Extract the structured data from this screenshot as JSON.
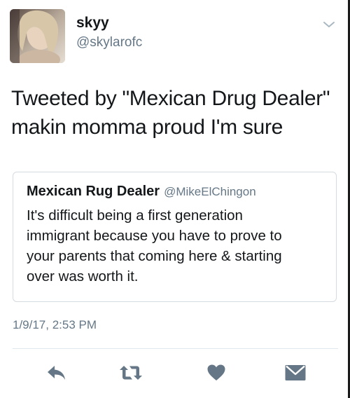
{
  "tweet": {
    "author": {
      "display_name": "skyy",
      "handle": "@skylarofc"
    },
    "text_lines": [
      "Tweeted by \"Mexican Drug Dealer\"",
      "makin momma proud I'm sure"
    ],
    "quoted": {
      "display_name": "Mexican Rug Dealer",
      "handle": "@MikeElChingon",
      "text_lines": [
        "It's difficult being a first generation",
        "immigrant because you have to prove to",
        "your parents that coming here & starting",
        "over was worth it."
      ]
    },
    "timestamp": "1/9/17, 2:53 PM",
    "actions": [
      "reply-icon",
      "retweet-icon",
      "like-heart-icon",
      "direct-message-icon"
    ],
    "icon_color": "#657786",
    "caret_color": "#aab8c2"
  }
}
